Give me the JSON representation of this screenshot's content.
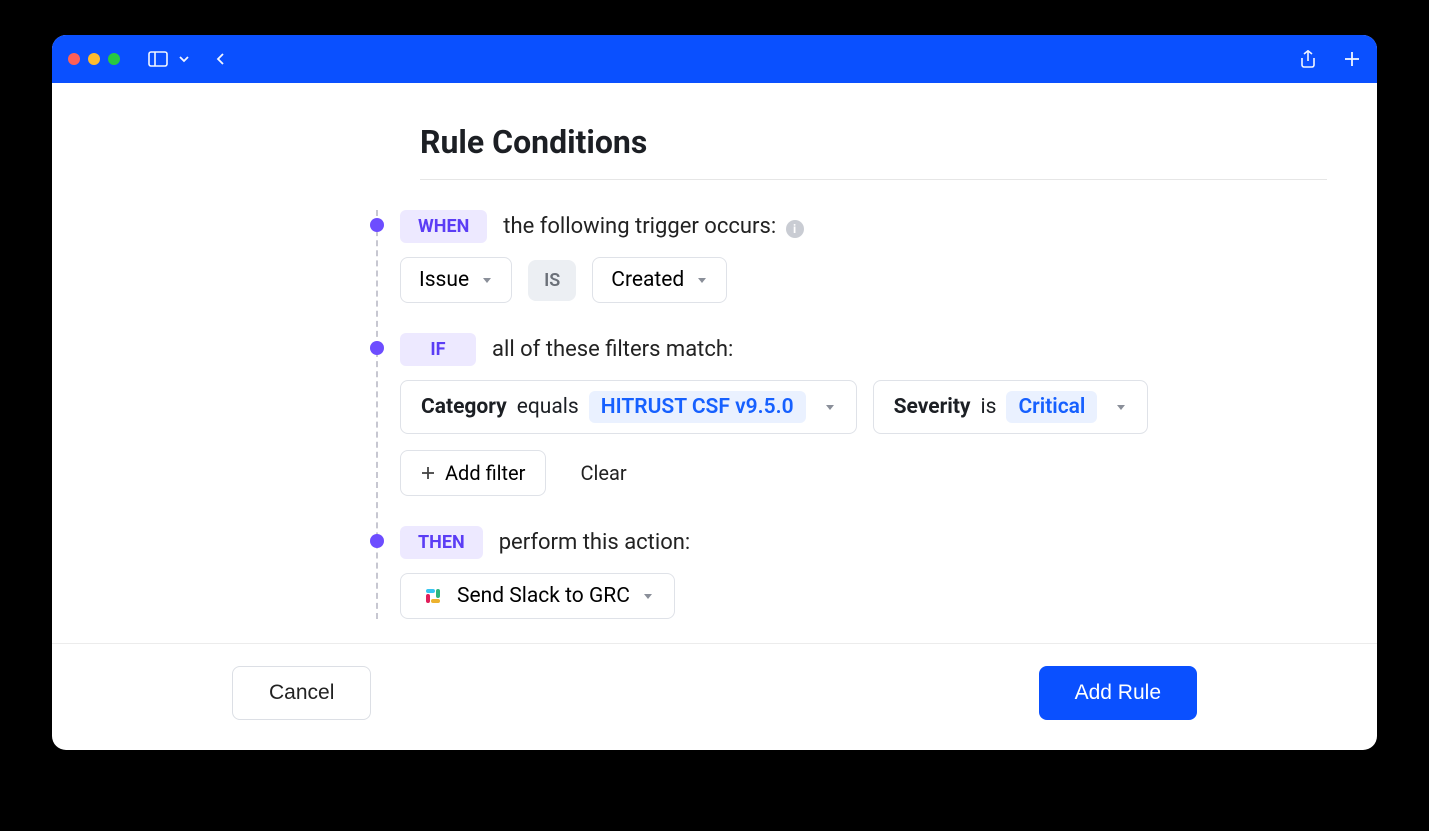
{
  "page_title": "Rule Conditions",
  "when": {
    "tag": "WHEN",
    "text": "the following trigger occurs:",
    "subject": "Issue",
    "operator": "IS",
    "event": "Created"
  },
  "if": {
    "tag": "IF",
    "text": "all of these filters match:",
    "filters": [
      {
        "field": "Category",
        "op": "equals",
        "value": "HITRUST CSF v9.5.0"
      },
      {
        "field": "Severity",
        "op": "is",
        "value": "Critical"
      }
    ],
    "add_filter_label": "Add filter",
    "clear_label": "Clear"
  },
  "then": {
    "tag": "THEN",
    "text": "perform this action:",
    "action": "Send Slack to GRC"
  },
  "footer": {
    "cancel": "Cancel",
    "submit": "Add Rule"
  }
}
